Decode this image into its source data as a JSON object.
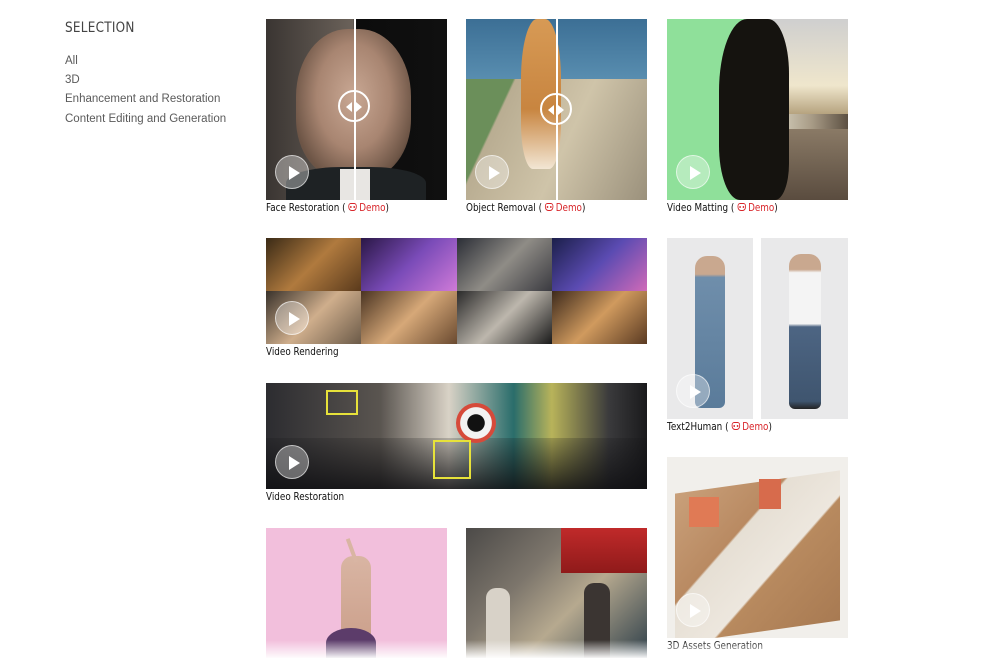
{
  "sidebar": {
    "title": "SELECTION",
    "filters": [
      "All",
      "3D",
      "Enhancement and Restoration",
      "Content Editing and Generation"
    ]
  },
  "gallery": [
    {
      "title": "Face Restoration",
      "demo_label": "Demo",
      "has_demo": true,
      "has_compare_slider": true
    },
    {
      "title": "Object Removal",
      "demo_label": "Demo",
      "has_demo": true,
      "has_compare_slider": true
    },
    {
      "title": "Video Matting",
      "demo_label": "Demo",
      "has_demo": true,
      "background": "#8fe09a"
    },
    {
      "title": "Video Rendering",
      "has_demo": false
    },
    {
      "title": "Text2Human",
      "demo_label": "Demo",
      "has_demo": true
    },
    {
      "title": "Video Restoration",
      "has_demo": false
    },
    {
      "title": "3D Assets Generation",
      "has_demo": false
    },
    {
      "title": "",
      "has_demo": false
    },
    {
      "title": "",
      "has_demo": false
    }
  ],
  "colors": {
    "accent": "#d8252a",
    "highlight_box": "#e7e23a"
  }
}
